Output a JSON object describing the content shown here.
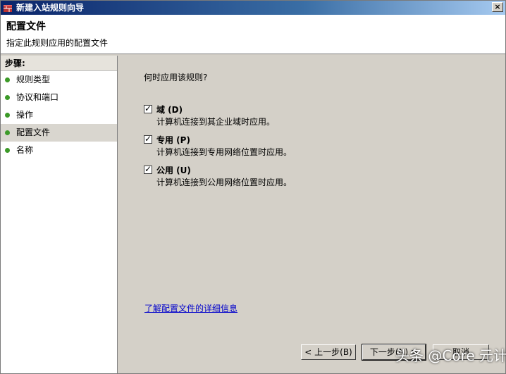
{
  "window": {
    "title": "新建入站规则向导",
    "close_label": "×"
  },
  "header": {
    "title": "配置文件",
    "subtitle": "指定此规则应用的配置文件"
  },
  "sidebar": {
    "heading": "步骤:",
    "items": [
      {
        "label": "规则类型"
      },
      {
        "label": "协议和端口"
      },
      {
        "label": "操作"
      },
      {
        "label": "配置文件"
      },
      {
        "label": "名称"
      }
    ]
  },
  "main": {
    "question": "何时应用该规则?",
    "options": [
      {
        "label": "域 (D)",
        "description": "计算机连接到其企业域时应用。",
        "checked": true
      },
      {
        "label": "专用 (P)",
        "description": "计算机连接到专用网络位置时应用。",
        "checked": true
      },
      {
        "label": "公用 (U)",
        "description": "计算机连接到公用网络位置时应用。",
        "checked": true
      }
    ],
    "help_link": "了解配置文件的详细信息"
  },
  "buttons": {
    "back": "< 上一步(B)",
    "next": "下一步(N) >",
    "cancel": "取消"
  },
  "watermark": "头条 @Core 元计算"
}
